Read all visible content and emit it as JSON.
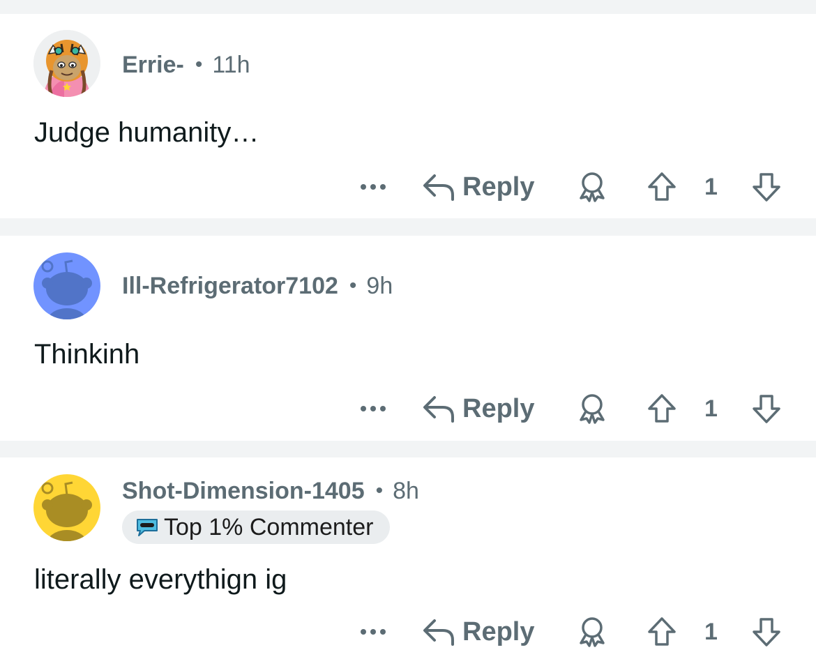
{
  "comments": [
    {
      "username": "Errie-",
      "separator": "•",
      "time": "11h",
      "body": "Judge humanity…",
      "avatar_icon": "tiger-hood-avatar-icon",
      "actions": {
        "more": "•••",
        "reply": "Reply",
        "score": "1"
      }
    },
    {
      "username": "Ill-Refrigerator7102",
      "separator": "•",
      "time": "9h",
      "body": "Thinkinh",
      "avatar_icon": "snoo-avatar-icon",
      "avatar_color": "#7193ff",
      "actions": {
        "more": "•••",
        "reply": "Reply",
        "score": "1"
      }
    },
    {
      "username": "Shot-Dimension-1405",
      "separator": "•",
      "time": "8h",
      "flair": "Top 1% Commenter",
      "body": "literally everythign ig",
      "avatar_icon": "snoo-avatar-icon",
      "avatar_color": "#ffd635",
      "actions": {
        "more": "•••",
        "reply": "Reply",
        "score": "1"
      }
    }
  ],
  "colors": {
    "separator": "#f2f4f5",
    "meta_text": "#5c6c74",
    "body_text": "#0f1a1c",
    "flair_bg": "#eaedef"
  }
}
